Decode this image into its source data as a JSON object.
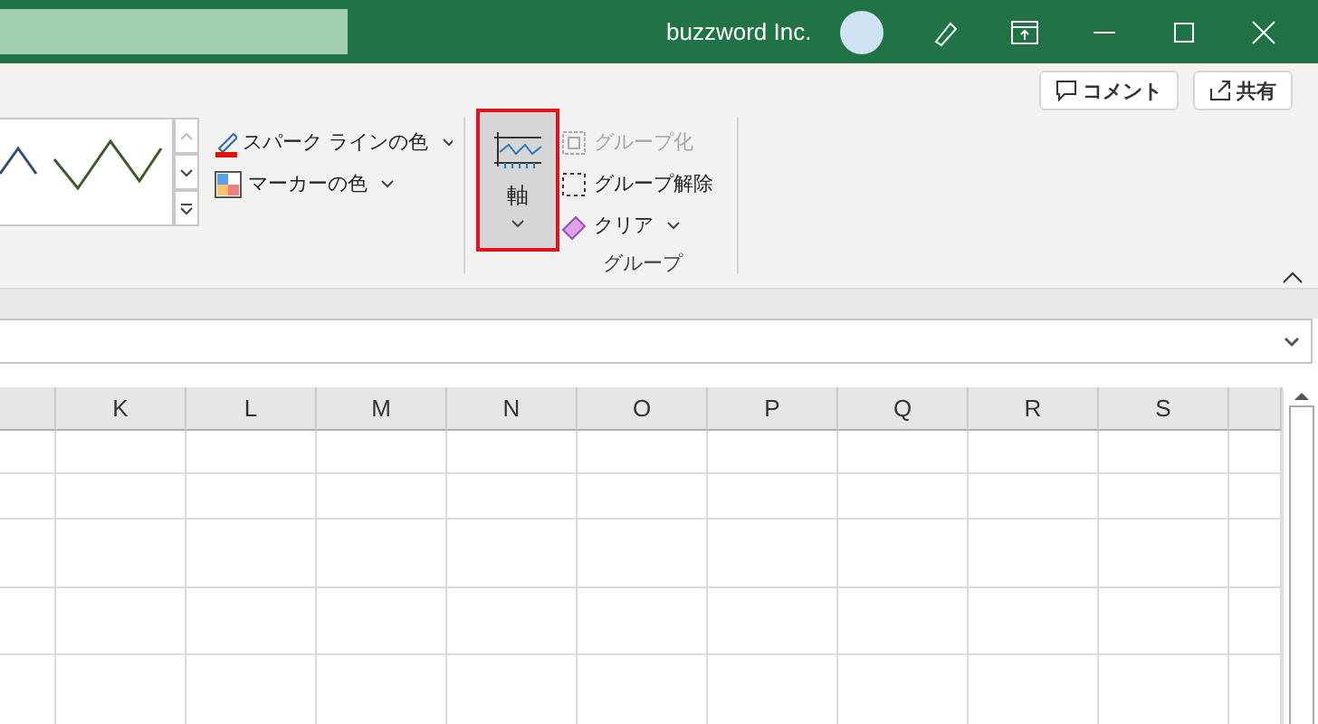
{
  "title_bar": {
    "account": "buzzword Inc."
  },
  "header_buttons": [
    {
      "label": "コメント",
      "kind": "comment"
    },
    {
      "label": "共有",
      "kind": "share"
    }
  ],
  "style_group": {
    "items": [
      {
        "label": "スパーク ラインの色",
        "kind": "pen"
      },
      {
        "label": "マーカーの色",
        "kind": "marker"
      }
    ]
  },
  "axis_button": {
    "label": "軸",
    "selected": true
  },
  "group_section": {
    "label": "グループ",
    "items": [
      {
        "label": "グループ化",
        "kind": "group",
        "disabled": true
      },
      {
        "label": "グループ解除",
        "kind": "ungroup",
        "disabled": false
      },
      {
        "label": "クリア",
        "kind": "clear",
        "disabled": false
      }
    ]
  },
  "sheet": {
    "columns": [
      "K",
      "L",
      "M",
      "N",
      "O",
      "P",
      "Q",
      "R",
      "S"
    ],
    "rows": [
      [],
      [],
      [],
      [],
      []
    ]
  }
}
